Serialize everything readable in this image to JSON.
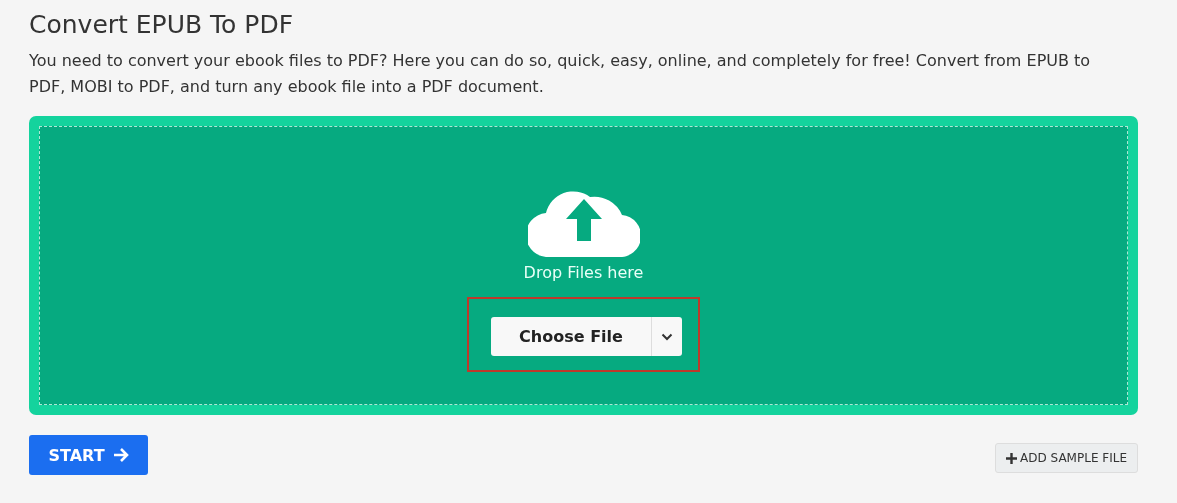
{
  "title": "Convert EPUB To PDF",
  "description": "You need to convert your ebook files to PDF? Here you can do so, quick, easy, online, and completely for free! Convert from EPUB to PDF, MOBI to PDF, and turn any ebook file into a PDF document.",
  "dropzone": {
    "hint": "Drop Files here",
    "button": "Choose File",
    "highlighted": true
  },
  "start_button": "START",
  "sample_button": "ADD SAMPLE FILE"
}
